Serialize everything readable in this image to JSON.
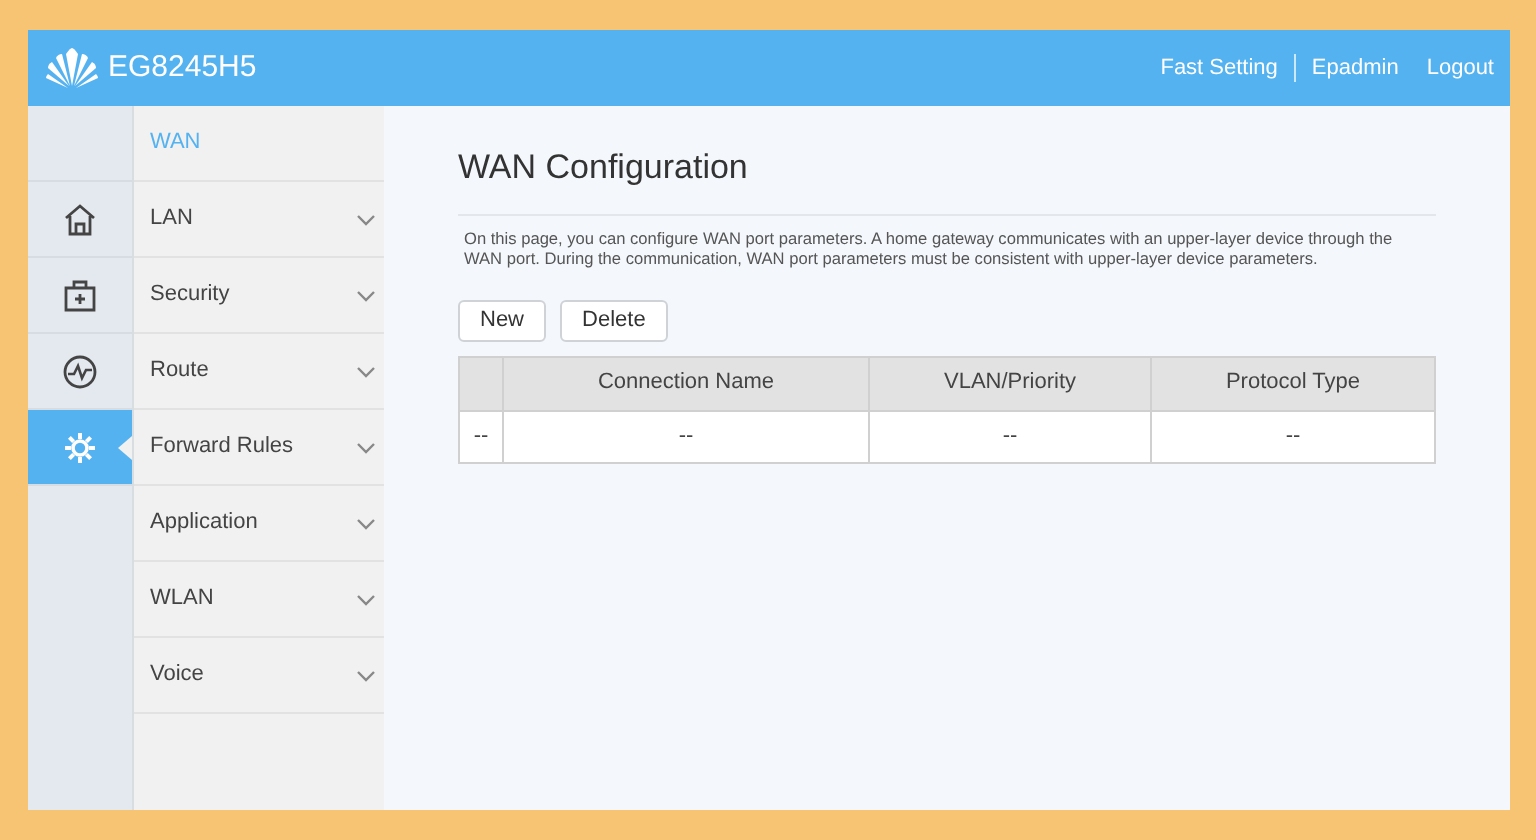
{
  "header": {
    "product": "EG8245H5",
    "links": [
      "Fast Setting",
      "Epadmin",
      "Logout"
    ]
  },
  "rail": [
    {
      "kind": "blank",
      "selected": false
    },
    {
      "kind": "home",
      "selected": false
    },
    {
      "kind": "kit",
      "selected": false
    },
    {
      "kind": "pulse",
      "selected": false
    },
    {
      "kind": "gear",
      "selected": true
    }
  ],
  "menu": [
    {
      "label": "WAN",
      "kind": "sub",
      "selected": true
    },
    {
      "label": "LAN",
      "kind": "group",
      "selected": false
    },
    {
      "label": "Security",
      "kind": "group",
      "selected": false
    },
    {
      "label": "Route",
      "kind": "group",
      "selected": false
    },
    {
      "label": "Forward Rules",
      "kind": "group",
      "selected": false
    },
    {
      "label": "Application",
      "kind": "group",
      "selected": false
    },
    {
      "label": "WLAN",
      "kind": "group",
      "selected": false
    },
    {
      "label": "Voice",
      "kind": "group",
      "selected": false
    }
  ],
  "page": {
    "title": "WAN Configuration",
    "description": "On this page, you can configure WAN port parameters. A home gateway communicates with an upper-layer device through the WAN port. During the communication, WAN port parameters must be consistent with upper-layer device parameters.",
    "buttons": [
      "New",
      "Delete"
    ]
  },
  "table": {
    "columns": [
      "",
      "Connection Name",
      "VLAN/Priority",
      "Protocol Type"
    ],
    "rows": [
      [
        "--",
        "--",
        "--",
        "--"
      ]
    ]
  }
}
